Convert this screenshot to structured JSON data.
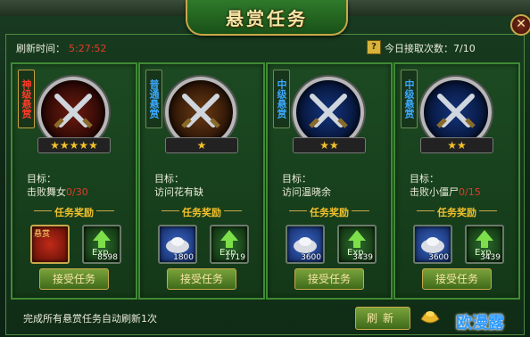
{
  "window": {
    "title": "悬赏任务",
    "close_symbol": "✕"
  },
  "header": {
    "refresh_label": "刷新时间：",
    "refresh_time": "5:27:52",
    "help_symbol": "?",
    "accept_count_label": "今日接取次数：7/10"
  },
  "cards": [
    {
      "tag": "神级悬赏",
      "stars": "★★★★★",
      "objective_label": "目标：",
      "objective_text": "击败舞女",
      "objective_progress": "0/30",
      "reward_title": "任务奖励",
      "items": [
        {
          "icon": "bounty-chest-icon",
          "label": "悬赏",
          "count": ""
        },
        {
          "icon": "exp-icon",
          "label": "",
          "count": "8598"
        }
      ],
      "button": "接受任务"
    },
    {
      "tag": "普通悬赏",
      "stars": "★",
      "objective_label": "目标：",
      "objective_text": "访问花有缺",
      "objective_progress": "",
      "reward_title": "任务奖励",
      "items": [
        {
          "icon": "silver-ingot-icon",
          "label": "",
          "count": "1800"
        },
        {
          "icon": "exp-icon",
          "label": "",
          "count": "1719"
        }
      ],
      "button": "接受任务"
    },
    {
      "tag": "中级悬赏",
      "stars": "★★",
      "objective_label": "目标：",
      "objective_text": "访问温晓余",
      "objective_progress": "",
      "reward_title": "任务奖励",
      "items": [
        {
          "icon": "silver-ingot-icon",
          "label": "",
          "count": "3600"
        },
        {
          "icon": "exp-icon",
          "label": "",
          "count": "3439"
        }
      ],
      "button": "接受任务"
    },
    {
      "tag": "中级悬赏",
      "stars": "★★",
      "objective_label": "目标：",
      "objective_text": "击败小僵尸",
      "objective_progress": "0/15",
      "reward_title": "任务奖励",
      "items": [
        {
          "icon": "silver-ingot-icon",
          "label": "",
          "count": "3600"
        },
        {
          "icon": "exp-icon",
          "label": "",
          "count": "3439"
        }
      ],
      "button": "接受任务"
    }
  ],
  "footer": {
    "note": "完成所有悬赏任务自动刷新1次",
    "refresh_button": "刷新",
    "currency_icon": "gold-ingot-icon"
  },
  "watermark": "欧漫露"
}
